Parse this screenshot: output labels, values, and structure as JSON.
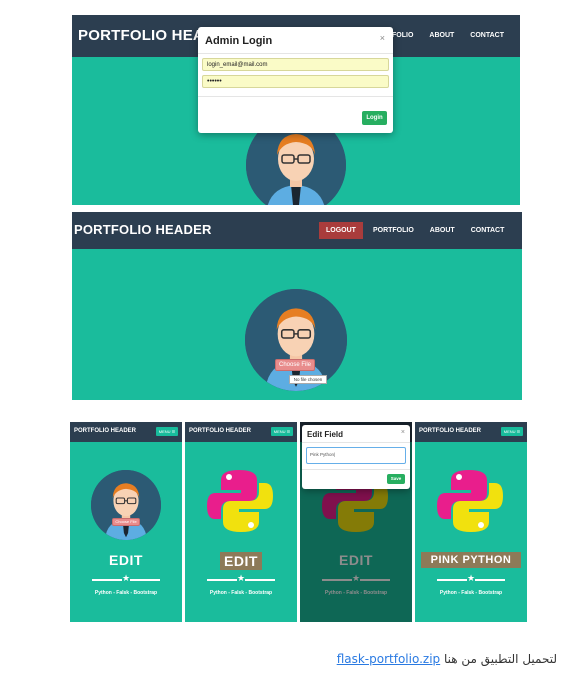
{
  "shot1": {
    "brand": "PORTFOLIO HEAD",
    "nav": [
      "FOLIO",
      "ABOUT",
      "CONTACT"
    ],
    "modal": {
      "title": "Admin Login",
      "close": "×",
      "email_value": "login_email@mail.com",
      "password_value": "••••••",
      "login_button": "Login"
    }
  },
  "shot2": {
    "brand": "PORTFOLIO HEADER",
    "nav": [
      "LOGOUT",
      "PORTFOLIO",
      "ABOUT",
      "CONTACT"
    ],
    "choose_file": "Choose File",
    "no_file": "No file chosen"
  },
  "phones": {
    "brand": "PORTFOLIO HEADER",
    "menu_label": "MENU ☰",
    "edit_label": "EDIT",
    "skills": "Python - Falsk - Bootstrap",
    "choose_file": "Choose File",
    "pink_python": "PINK PYTHON",
    "edit_field": {
      "title": "Edit Field",
      "close": "×",
      "input_value": "Pink Python|",
      "save_button": "Save"
    }
  },
  "footer": {
    "text": "لتحميل التطبيق من هنا",
    "link": "flask-portfolio.zip"
  },
  "colors": {
    "navy": "#2c3e50",
    "teal": "#1abc9c",
    "green_button": "#27ae60",
    "logout_button": "#a93c3c"
  }
}
